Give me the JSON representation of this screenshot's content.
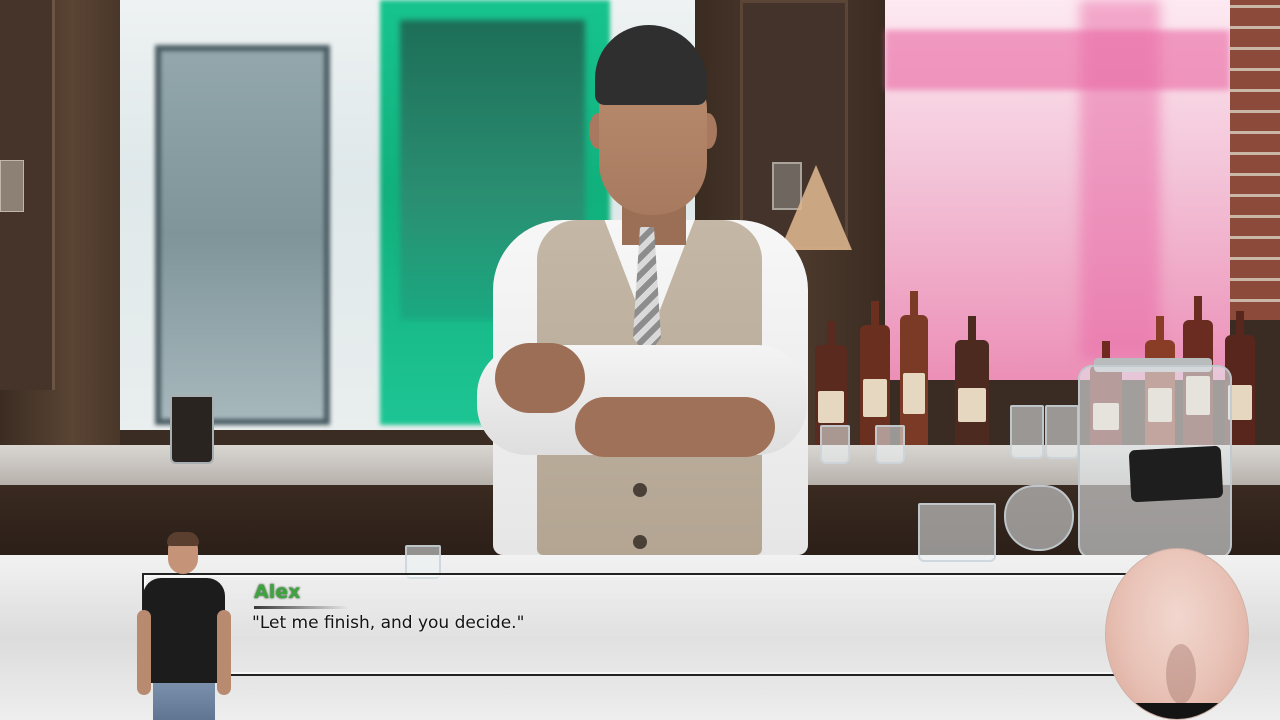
{
  "dialogue": {
    "speaker": "Alex",
    "text": "\"Let me finish, and you decide.\""
  },
  "colors": {
    "speaker_name": "#3fa33f",
    "dialogue_text": "#141414",
    "dialogue_border": "#222222"
  },
  "icons": {
    "side_portrait": "character-portrait-alex",
    "circle_portrait": "character-closeup"
  }
}
